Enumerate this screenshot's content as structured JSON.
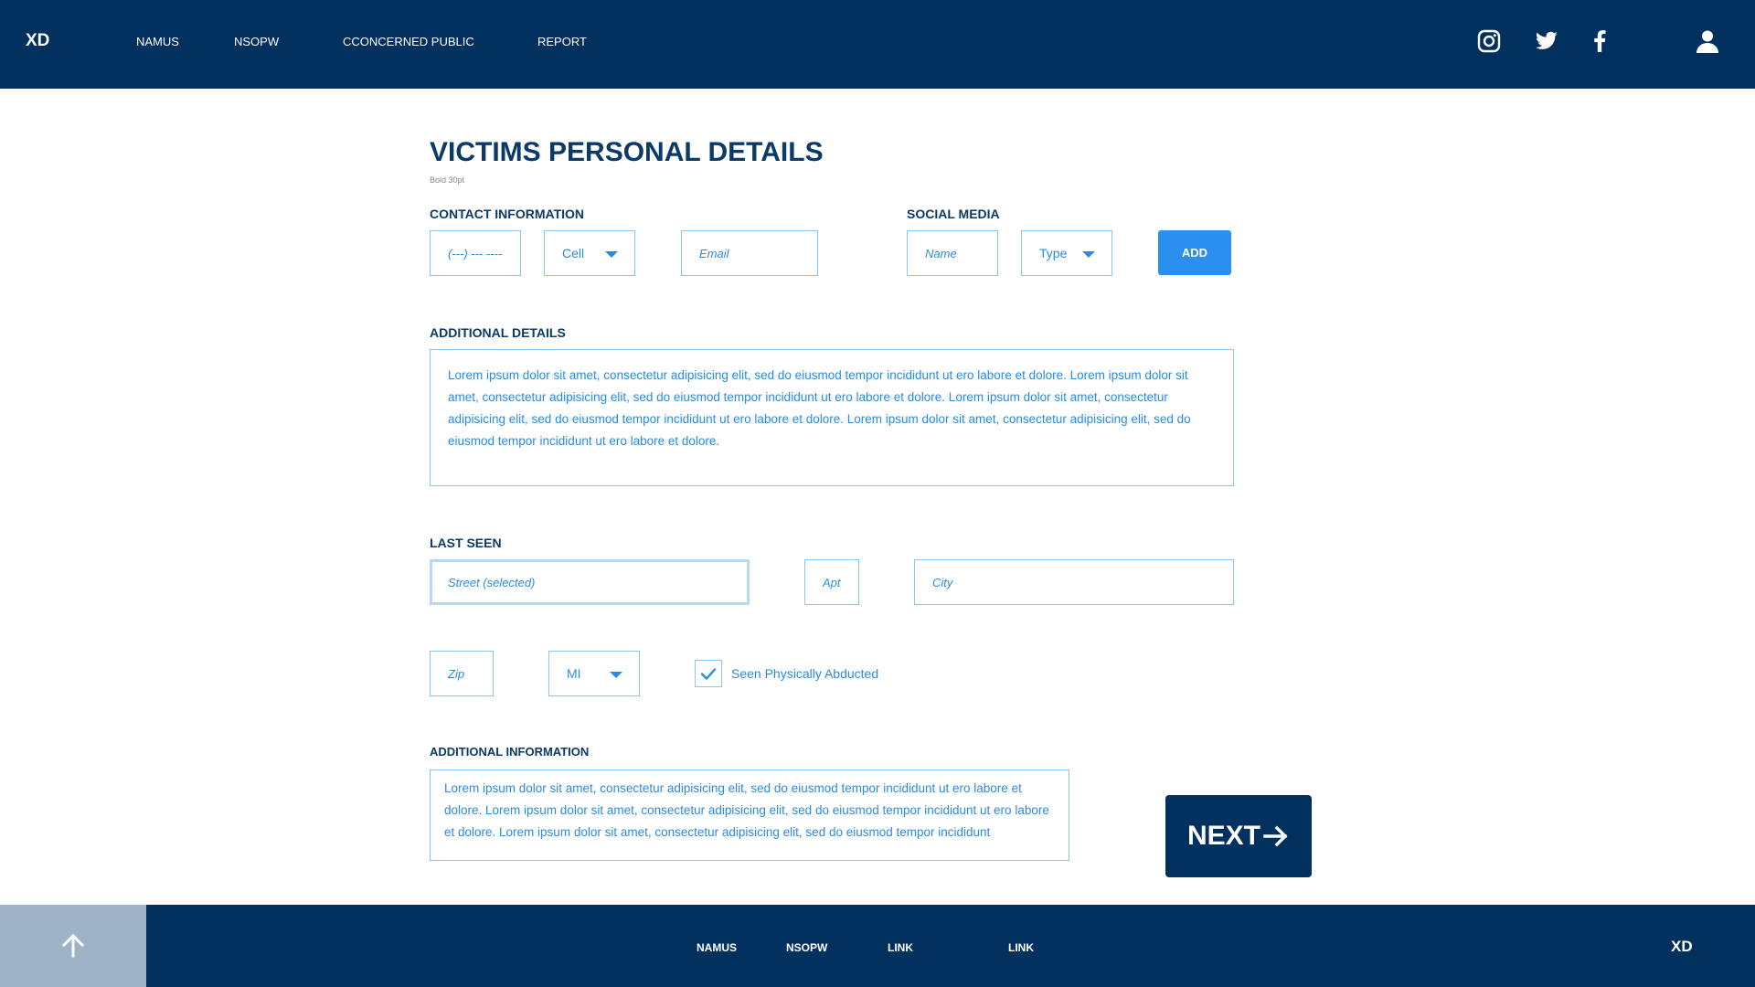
{
  "header": {
    "logo": "XD",
    "nav": [
      "NAMUS",
      "NSOPW",
      "CCONCERNED PUBLIC",
      "REPORT"
    ],
    "icons": [
      "instagram-icon",
      "twitter-icon",
      "facebook-icon",
      "user-icon"
    ]
  },
  "page": {
    "title": "VICTIMS PERSONAL DETAILS",
    "subnote": "Bold 30pt"
  },
  "contact": {
    "label": "CONTACT INFORMATION",
    "phone_placeholder": "(---) --- ----",
    "phone_type": "Cell",
    "email_placeholder": "Email"
  },
  "social": {
    "label": "SOCIAL MEDIA",
    "name_placeholder": "Name",
    "type_value": "Type",
    "add_label": "ADD"
  },
  "additional_details": {
    "label": "ADDITIONAL DETAILS",
    "text": "Lorem ipsum dolor sit amet, consectetur adipisicing elit, sed do eiusmod tempor incididunt ut ero labore et dolore. Lorem ipsum dolor sit amet, consectetur adipisicing elit, sed do eiusmod tempor incididunt ut ero labore et dolore. Lorem ipsum dolor sit amet, consectetur adipisicing elit, sed do eiusmod tempor incididunt ut ero labore et dolore. Lorem ipsum dolor sit amet, consectetur adipisicing elit, sed do eiusmod tempor incididunt ut ero labore et dolore."
  },
  "last_seen": {
    "label": "LAST SEEN",
    "street_placeholder": "Street (selected)",
    "apt_placeholder": "Apt",
    "city_placeholder": "City",
    "zip_placeholder": "Zip",
    "state_value": "MI",
    "checkbox_label": "Seen Physically Abducted",
    "checkbox_checked": true
  },
  "additional_info": {
    "label": "ADDITIONAL INFORMATION",
    "text": "Lorem ipsum dolor sit amet, consectetur adipisicing elit, sed do eiusmod tempor incididunt ut ero labore et dolore. Lorem ipsum dolor sit amet, consectetur adipisicing elit, sed do eiusmod tempor incididunt ut ero labore et dolore. Lorem ipsum dolor sit amet, consectetur adipisicing elit, sed do eiusmod tempor incididunt"
  },
  "next_label": "NEXT",
  "footer": {
    "links": [
      "NAMUS",
      "NSOPW",
      "LINK",
      "LINK"
    ],
    "logo": "XD"
  },
  "colors": {
    "navy": "#023160",
    "accent_blue": "#2b8ff0",
    "field_text": "#2b8be0",
    "field_border": "#8ec3f0",
    "footer_scroll": "#9eb2c8"
  }
}
